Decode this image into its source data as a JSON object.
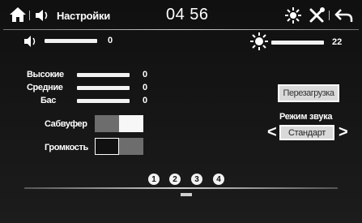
{
  "header": {
    "title": "Настройки",
    "clock": "04 56"
  },
  "levels": {
    "volume_value": "0",
    "brightness_value": "22",
    "volume_fraction": 0.0,
    "brightness_fraction": 0.55
  },
  "equalizer": {
    "rows": [
      {
        "label": "Высокие",
        "value": "0"
      },
      {
        "label": "Средние",
        "value": "0"
      },
      {
        "label": "Бас",
        "value": "0"
      }
    ]
  },
  "toggles": {
    "subwoofer_label": "Сабвуфер",
    "subwoofer_on": true,
    "loudness_label": "Громкость",
    "loudness_on": false
  },
  "sound_mode": {
    "reset_label": "Перезагрузка",
    "mode_label": "Режим звука",
    "mode_value": "Стандарт",
    "prev_arrow": "<",
    "next_arrow": ">"
  },
  "pagination": {
    "pages": [
      "1",
      "2",
      "3",
      "4"
    ]
  },
  "icons": [
    "home-icon",
    "speaker-icon",
    "brightness-icon",
    "tools-icon",
    "back-icon",
    "volume-icon",
    "sun-icon"
  ]
}
